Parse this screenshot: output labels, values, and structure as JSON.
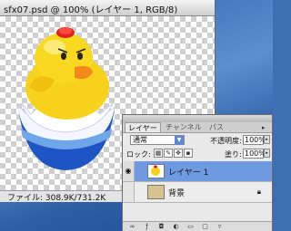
{
  "document": {
    "title": "sfx07.psd @ 100% (レイヤー 1, RGB/8)",
    "status": "ファイル: 308.9K/731.2K"
  },
  "layers_palette": {
    "tabs": [
      "レイヤー",
      "チャンネル",
      "パス"
    ],
    "blend_mode": "通常",
    "opacity_label": "不透明度:",
    "opacity_value": "100%",
    "lock_label": "ロック:",
    "fill_label": "塗り:",
    "fill_value": "100%",
    "layers": [
      {
        "name": "レイヤー 1",
        "visible": true,
        "selected": true
      },
      {
        "name": "背景",
        "visible": false,
        "selected": false,
        "locked": true
      }
    ]
  },
  "colors": {
    "selection": "#6d9ae0",
    "desktop": "#3d6fb3",
    "duck_yellow": "#f7d21b",
    "cup_blue": "#1d55c4"
  },
  "icons": [
    "eye-icon",
    "lock-icon",
    "palette-menu-icon",
    "link-icon",
    "fx-icon",
    "mask-icon",
    "adjustment-icon",
    "folder-icon",
    "new-layer-icon",
    "trash-icon"
  ]
}
